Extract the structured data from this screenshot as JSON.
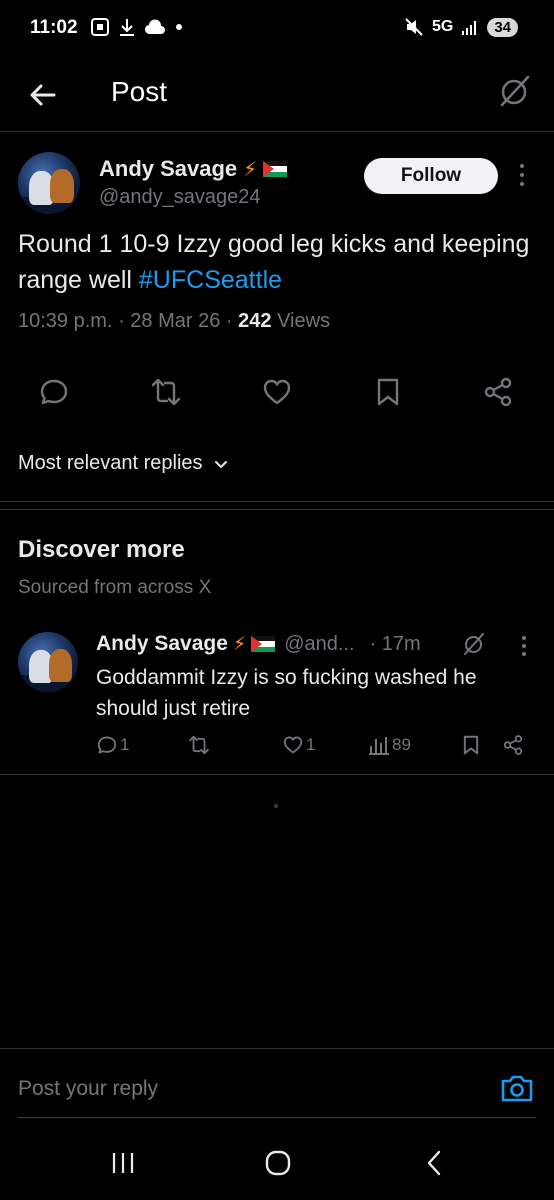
{
  "status_bar": {
    "time": "11:02",
    "network": "5G",
    "battery": "34",
    "icons": [
      "screenshot-icon",
      "download-icon",
      "cloud-icon",
      "dot-icon",
      "mute-icon",
      "signal-icon"
    ]
  },
  "header": {
    "title": "Post",
    "back_icon": "arrow-left-icon",
    "grok_icon": "grok-icon"
  },
  "post": {
    "author_name": "Andy Savage",
    "author_badges": [
      "lightning-icon",
      "palestine-flag"
    ],
    "handle": "@andy_savage24",
    "follow_label": "Follow",
    "text_before_tag": "Round 1 10-9 Izzy good leg kicks and keeping range well ",
    "hashtag": "#UFCSeattle",
    "time": "10:39 p.m.",
    "date": "28 Mar 26",
    "views_count": "242",
    "views_label": "Views",
    "actions": [
      "reply-icon",
      "repost-icon",
      "like-icon",
      "bookmark-icon",
      "share-icon"
    ],
    "replies_sort_label": "Most relevant replies"
  },
  "discover": {
    "title": "Discover more",
    "subtitle": "Sourced from across X",
    "items": [
      {
        "author_name": "Andy Savage",
        "handle": "@and...",
        "time": "· 17m",
        "text": "Goddammit Izzy is so fucking washed he should just retire",
        "reply_count": "1",
        "repost_count": "",
        "like_count": "1",
        "views_count": "89"
      }
    ]
  },
  "reply_bar": {
    "placeholder": "Post your reply"
  },
  "colors": {
    "background": "#000000",
    "text": "#e7e9ea",
    "secondary": "#71767b",
    "accent": "#1d9bf0",
    "divider": "#2f3336"
  }
}
